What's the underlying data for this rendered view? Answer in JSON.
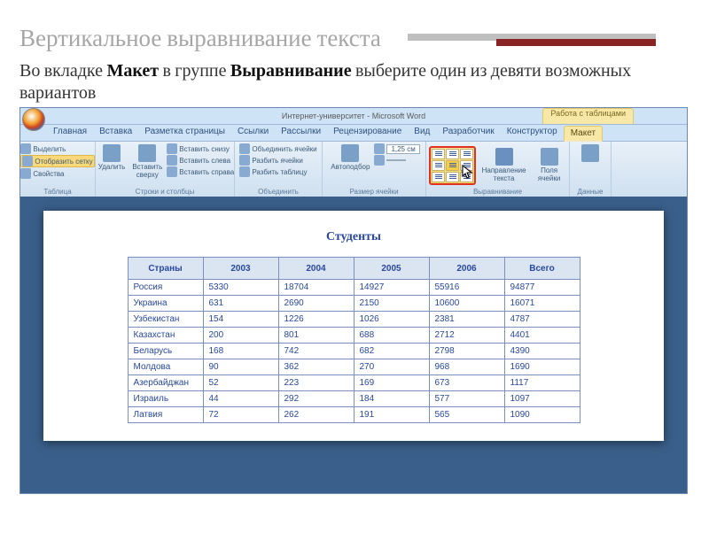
{
  "slide": {
    "heading": "Вертикальное выравнивание текста",
    "body_parts": {
      "p1a": "Во вкладке ",
      "p1b": "Макет",
      "p1c": " в группе ",
      "p1d": "Выравнивание",
      "p1e": " выберите один из девяти возможных вариантов"
    }
  },
  "word": {
    "caption": "Интернет-университет - Microsoft Word",
    "context_tab_group": "Работа с таблицами",
    "tabs": [
      "Главная",
      "Вставка",
      "Разметка страницы",
      "Ссылки",
      "Рассылки",
      "Рецензирование",
      "Вид",
      "Разработчик",
      "Конструктор",
      "Макет"
    ],
    "active_tab_index": 9,
    "ribbon": {
      "g_table": {
        "label": "Таблица",
        "btn_select": "Выделить",
        "btn_grid": "Отобразить сетку",
        "btn_props": "Свойства"
      },
      "g_rowscols": {
        "label": "Строки и столбцы",
        "btn_delete": "Удалить",
        "btn_above": "Вставить сверху",
        "btn_below": "Вставить снизу",
        "btn_left": "Вставить слева",
        "btn_right": "Вставить справа"
      },
      "g_merge": {
        "label": "Объединить",
        "btn_merge": "Объединить ячейки",
        "btn_split": "Разбить ячейки",
        "btn_splittbl": "Разбить таблицу"
      },
      "g_cellsize": {
        "label": "Размер ячейки",
        "btn_autofit": "Автоподбор",
        "h": "1,25 см",
        "w": " "
      },
      "g_align": {
        "label": "Выравнивание",
        "btn_dir": "Направление текста",
        "btn_margins": "Поля ячейки"
      },
      "g_data": {
        "label": "Данные"
      }
    }
  },
  "document": {
    "title": "Студенты",
    "columns": [
      "Страны",
      "2003",
      "2004",
      "2005",
      "2006",
      "Всего"
    ],
    "rows": [
      [
        "Россия",
        "5330",
        "18704",
        "14927",
        "55916",
        "94877"
      ],
      [
        "Украина",
        "631",
        "2690",
        "2150",
        "10600",
        "16071"
      ],
      [
        "Узбекистан",
        "154",
        "1226",
        "1026",
        "2381",
        "4787"
      ],
      [
        "Казахстан",
        "200",
        "801",
        "688",
        "2712",
        "4401"
      ],
      [
        "Беларусь",
        "168",
        "742",
        "682",
        "2798",
        "4390"
      ],
      [
        "Молдова",
        "90",
        "362",
        "270",
        "968",
        "1690"
      ],
      [
        "Азербайджан",
        "52",
        "223",
        "169",
        "673",
        "1117"
      ],
      [
        "Израиль",
        "44",
        "292",
        "184",
        "577",
        "1097"
      ],
      [
        "Латвия",
        "72",
        "262",
        "191",
        "565",
        "1090"
      ]
    ]
  }
}
